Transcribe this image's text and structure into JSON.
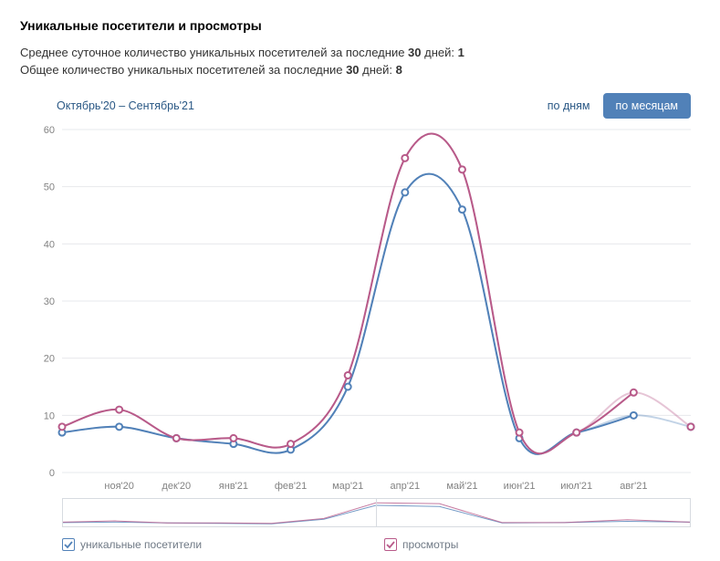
{
  "title": "Уникальные посетители и просмотры",
  "stats": {
    "avg_prefix": "Среднее суточное количество уникальных посетителей за последние ",
    "total_prefix": "Общее количество уникальных посетителей за последние ",
    "days_bold": "30",
    "days_suffix": " дней: ",
    "avg_value": "1",
    "total_value": "8"
  },
  "period_label": "Октябрь'20 – Сентябрь'21",
  "toggle": {
    "daily": "по дням",
    "monthly": "по месяцам"
  },
  "legend": {
    "visitors": "уникальные посетители",
    "views": "просмотры"
  },
  "colors": {
    "visitors": "#5181b8",
    "views": "#b85a89"
  },
  "chart_data": {
    "type": "line",
    "title": "Уникальные посетители и просмотры",
    "xlabel": "",
    "ylabel": "",
    "ylim": [
      0,
      60
    ],
    "categories": [
      "окт'20",
      "ноя'20",
      "дек'20",
      "янв'21",
      "фев'21",
      "мар'21",
      "апр'21",
      "май'21",
      "июн'21",
      "июл'21",
      "авг'21",
      "сен'21"
    ],
    "x_tick_labels": [
      "ноя'20",
      "дек'20",
      "янв'21",
      "фев'21",
      "мар'21",
      "апр'21",
      "май'21",
      "июн'21",
      "июл'21",
      "авг'21"
    ],
    "series": [
      {
        "name": "уникальные посетители",
        "color": "#5181b8",
        "values": [
          7,
          8,
          6,
          5,
          4,
          15,
          49,
          46,
          6,
          7,
          10,
          8
        ]
      },
      {
        "name": "просмотры",
        "color": "#b85a89",
        "values": [
          8,
          11,
          6,
          6,
          5,
          17,
          55,
          53,
          7,
          7,
          14,
          8
        ]
      }
    ],
    "y_ticks": [
      0,
      10,
      20,
      30,
      40,
      50,
      60
    ]
  }
}
